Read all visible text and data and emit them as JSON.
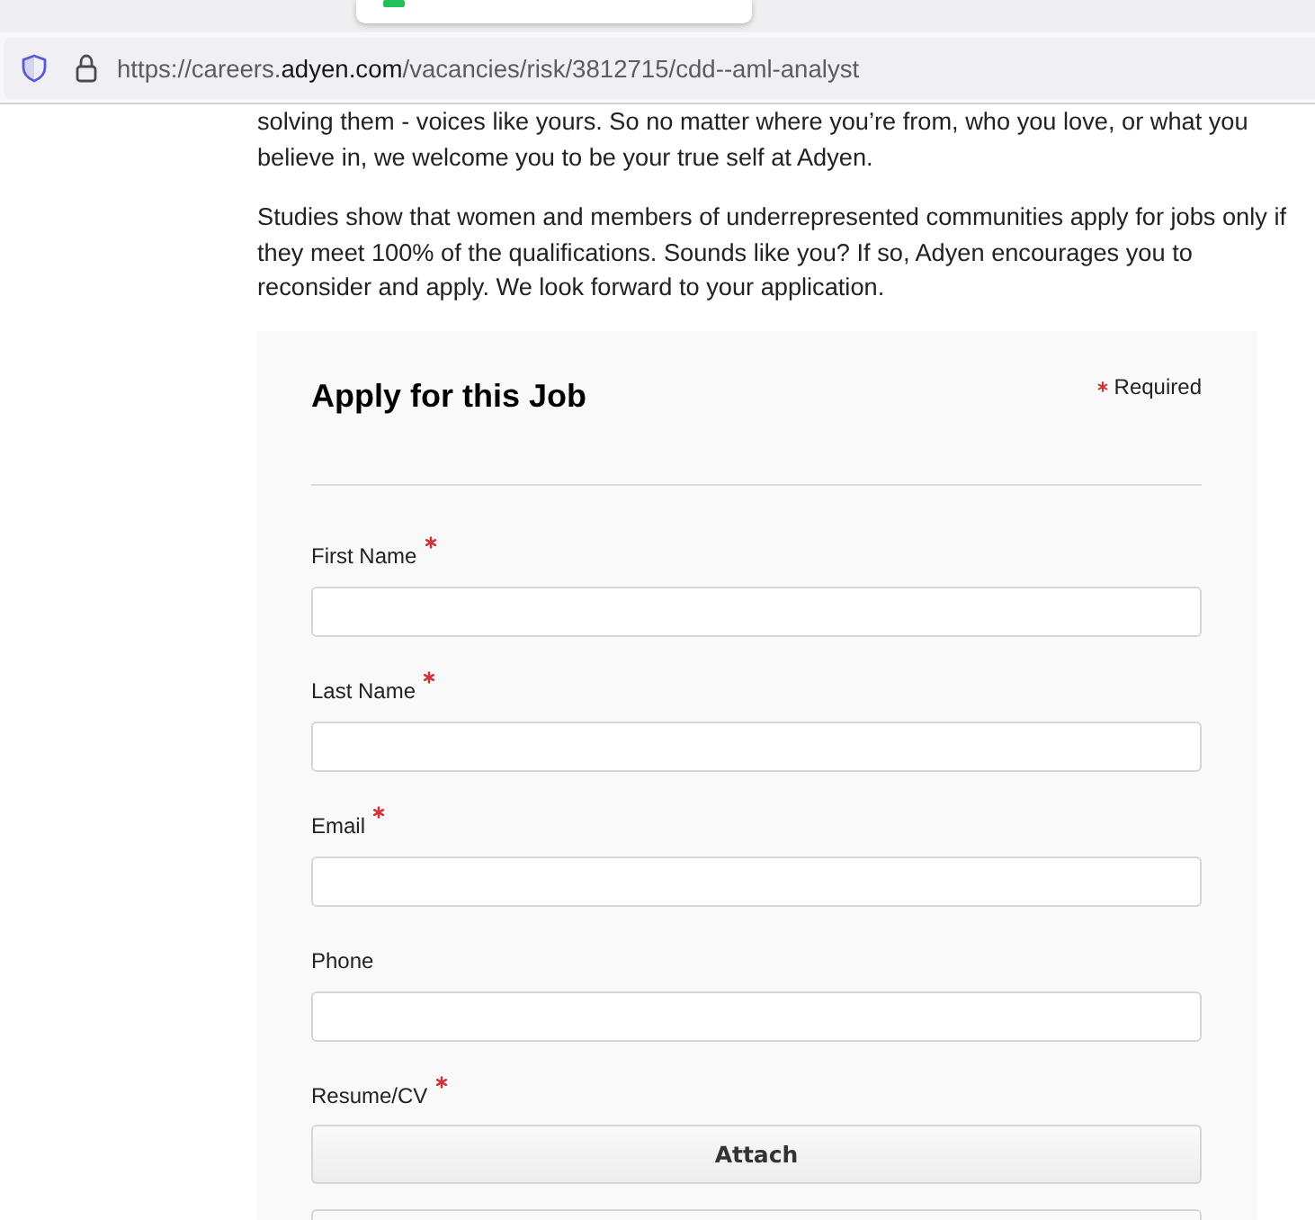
{
  "browser": {
    "tab_preview_shown": true,
    "address_bar": {
      "url_start": "https://careers.",
      "url_domain": "adyen.com",
      "url_rest": "/vacancies/risk/3812715/cdd--aml-analyst"
    }
  },
  "page": {
    "paragraphs": [
      "solving them - voices like yours. So no matter where you’re from, who you love, or what you believe in, we welcome you to be your true self at Adyen.",
      "Studies show that women and members of underrepresented communities apply for jobs only if they meet 100% of the qualifications. Sounds like you? If so, Adyen encourages you to reconsider and apply. We look forward to your application."
    ]
  },
  "application_form": {
    "title": "Apply for this Job",
    "required_note": "Required",
    "fields": [
      {
        "label": "First Name",
        "required": true,
        "kind": "text"
      },
      {
        "label": "Last Name",
        "required": true,
        "kind": "text"
      },
      {
        "label": "Email",
        "required": true,
        "kind": "text"
      },
      {
        "label": "Phone",
        "required": false,
        "kind": "text"
      },
      {
        "label": "Resume/CV",
        "required": true,
        "kind": "file",
        "buttons": [
          "Attach"
        ],
        "more_buttons_cut_off": true
      }
    ]
  }
}
